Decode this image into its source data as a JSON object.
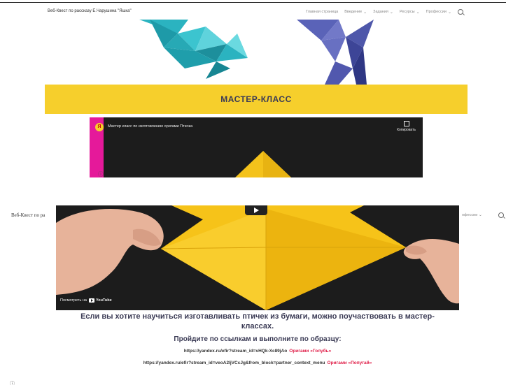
{
  "top": {
    "site_title": "Веб-Квест по рассказу Е.Чарушина \"Яшка\"",
    "nav": [
      {
        "label": "Главная страница",
        "has_menu": false
      },
      {
        "label": "Введение",
        "has_menu": true
      },
      {
        "label": "Задания",
        "has_menu": true
      },
      {
        "label": "Ресурсы",
        "has_menu": true
      },
      {
        "label": "Профессии",
        "has_menu": true
      }
    ],
    "banner_title": "МАСТЕР-КЛАСС",
    "video": {
      "channel_letter": "Я",
      "title": "Мастер класс по изготовлению оригами Птичка",
      "copy_label": "Копировать"
    }
  },
  "bottom": {
    "site_title": "Веб-Квест по ра",
    "nav_fragment": "офессии",
    "video": {
      "watch_on": "Посмотреть на",
      "platform": "YouTube"
    },
    "lead_text": "Если вы хотите научиться изготавливать птичек из бумаги, можно поучаствовать в мастер-классах.",
    "instruction": "Пройдите по ссылкам и выполните по образцу:",
    "links": [
      {
        "url": "https://yandex.ru/efir?stream_id=vHQk-Xc89jAo",
        "tag": "Оригами «Голубь»"
      },
      {
        "url": "https://yandex.ru/efir?stream_id=veoA2IjVCcJg&from_block=partner_context_menu",
        "tag": "Оригами «Попугай»"
      }
    ]
  },
  "colors": {
    "banner": "#f6cf2c",
    "heading_text": "#3b3b55",
    "link_tag": "#e0204a",
    "video_bg": "#1c1c1c",
    "bird_teal": "#2bb3c0",
    "bird_purple": "#5a63b8"
  },
  "icons": [
    "search-icon",
    "chevron-down-icon",
    "info-icon",
    "copy-icon",
    "play-icon",
    "youtube-logo-icon"
  ]
}
